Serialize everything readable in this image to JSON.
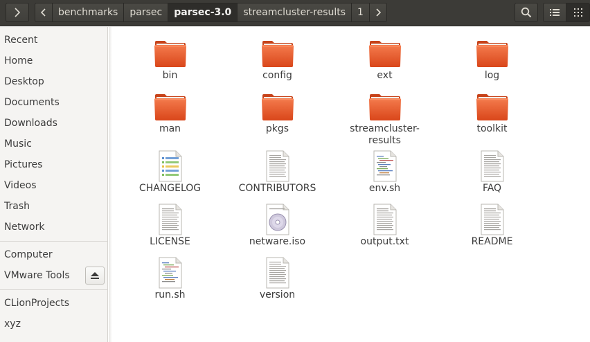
{
  "header": {
    "breadcrumbs": [
      {
        "label": "benchmarks",
        "active": false
      },
      {
        "label": "parsec",
        "active": false
      },
      {
        "label": "parsec-3.0",
        "active": true
      },
      {
        "label": "streamcluster-results",
        "active": false
      },
      {
        "label": "1",
        "active": false
      }
    ],
    "icons": [
      "sidebar-toggle-icon",
      "back-arrow-icon",
      "forward-arrow-icon",
      "search-icon",
      "list-view-icon",
      "grid-view-icon"
    ]
  },
  "sidebar": {
    "items": [
      {
        "label": "Recent"
      },
      {
        "label": "Home"
      },
      {
        "label": "Desktop"
      },
      {
        "label": "Documents"
      },
      {
        "label": "Downloads"
      },
      {
        "label": "Music"
      },
      {
        "label": "Pictures"
      },
      {
        "label": "Videos"
      },
      {
        "label": "Trash"
      },
      {
        "label": "Network"
      }
    ],
    "devices": [
      {
        "label": "Computer"
      },
      {
        "label": "VMware Tools"
      }
    ],
    "bookmarks": [
      {
        "label": "CLionProjects"
      },
      {
        "label": "xyz"
      }
    ]
  },
  "files": [
    {
      "name": "bin",
      "type": "folder"
    },
    {
      "name": "config",
      "type": "folder"
    },
    {
      "name": "ext",
      "type": "folder"
    },
    {
      "name": "log",
      "type": "folder"
    },
    {
      "name": "man",
      "type": "folder"
    },
    {
      "name": "pkgs",
      "type": "folder"
    },
    {
      "name": "streamcluster-\nresults",
      "type": "folder"
    },
    {
      "name": "toolkit",
      "type": "folder"
    },
    {
      "name": "CHANGELOG",
      "type": "changelog"
    },
    {
      "name": "CONTRIBUTORS",
      "type": "text"
    },
    {
      "name": "env.sh",
      "type": "script"
    },
    {
      "name": "FAQ",
      "type": "text"
    },
    {
      "name": "LICENSE",
      "type": "text"
    },
    {
      "name": "netware.iso",
      "type": "disc"
    },
    {
      "name": "output.txt",
      "type": "text"
    },
    {
      "name": "README",
      "type": "text"
    },
    {
      "name": "run.sh",
      "type": "script"
    },
    {
      "name": "version",
      "type": "text"
    }
  ],
  "colors": {
    "header_bg": "#3c3b37",
    "folder_orange": "#e95420",
    "sidebar_bg": "#f5f4f2"
  }
}
